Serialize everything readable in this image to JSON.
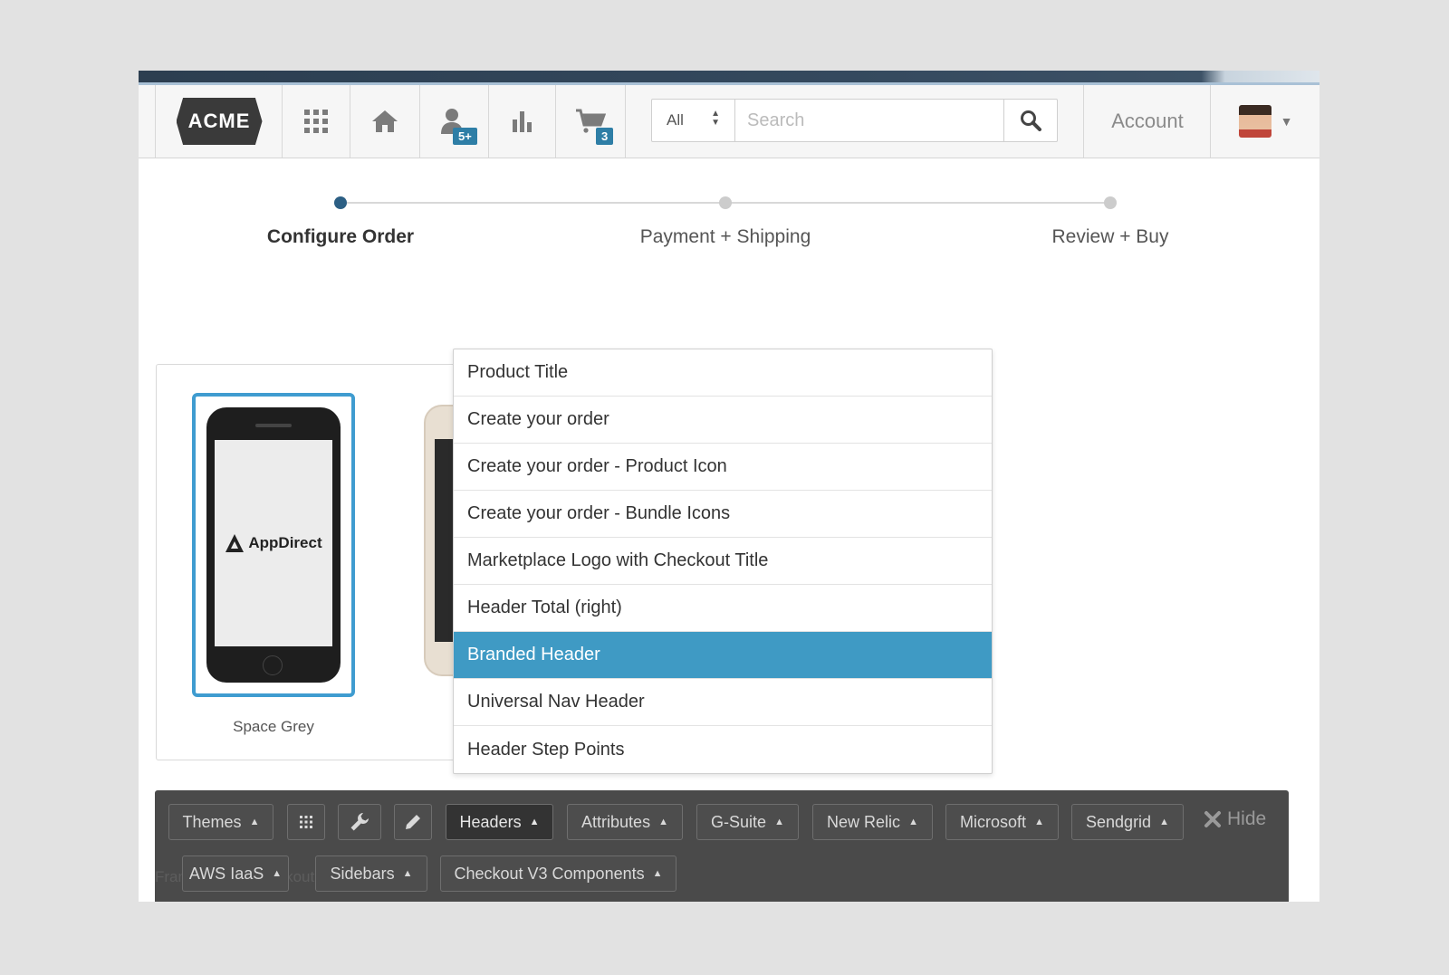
{
  "nav": {
    "logo": "ACME",
    "friends_badge": "5+",
    "cart_badge": "3",
    "search": {
      "scope": "All",
      "placeholder": "Search"
    },
    "account_label": "Account"
  },
  "steps": [
    {
      "label": "Configure Order",
      "active": true
    },
    {
      "label": "Payment + Shipping",
      "active": false
    },
    {
      "label": "Review + Buy",
      "active": false
    }
  ],
  "product": {
    "screen_brand": "AppDirect",
    "swatch_label": "Space Grey"
  },
  "dropdown": {
    "items": [
      "Product Title",
      "Create your order",
      "Create your order - Product Icon",
      "Create your order - Bundle Icons",
      "Marketplace Logo with Checkout Title",
      "Header Total (right)",
      "Branded Header",
      "Universal Nav Header",
      "Header Step Points"
    ],
    "selected": "Branded Header"
  },
  "toolbar": {
    "themes": "Themes",
    "headers": "Headers",
    "attributes": "Attributes",
    "gsuite": "G-Suite",
    "newrelic": "New Relic",
    "microsoft": "Microsoft",
    "sendgrid": "Sendgrid",
    "hide": "Hide",
    "aws": "AWS IaaS",
    "sidebars": "Sidebars",
    "checkout": "Checkout V3 Components",
    "ghost_text": "Framework  >  Checkout V3"
  },
  "colors": {
    "accent": "#3f9ac4",
    "badge": "#2e7ea6",
    "step_active": "#2c5f84",
    "toolbar_bg": "#4a4a4a"
  }
}
